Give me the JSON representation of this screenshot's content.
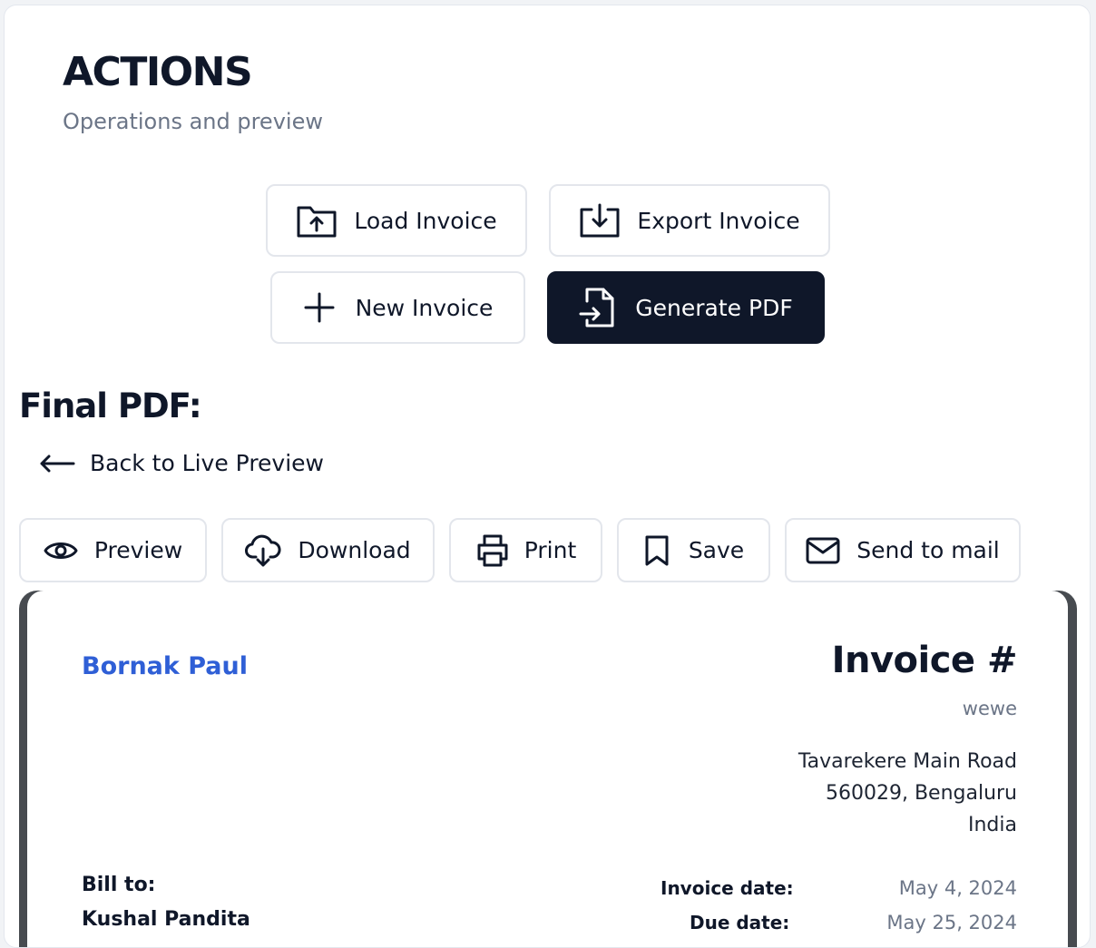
{
  "header": {
    "title": "ACTIONS",
    "subtitle": "Operations and preview"
  },
  "actions": {
    "load_label": "Load Invoice",
    "export_label": "Export Invoice",
    "new_label": "New Invoice",
    "generate_label": "Generate PDF"
  },
  "final_pdf": {
    "title": "Final PDF:",
    "back_label": "Back to Live Preview"
  },
  "toolbar": {
    "preview_label": "Preview",
    "download_label": "Download",
    "print_label": "Print",
    "save_label": "Save",
    "mail_label": "Send to mail"
  },
  "invoice": {
    "sender_name": "Bornak Paul",
    "heading": "Invoice #",
    "number": "wewe",
    "address": [
      "Tavarekere Main Road",
      "560029, Bengaluru",
      "India"
    ],
    "bill_to_label": "Bill to:",
    "client_name": "Kushal Pandita",
    "invoice_date_label": "Invoice date:",
    "invoice_date": "May 4, 2024",
    "due_date_label": "Due date:",
    "due_date": "May 25, 2024"
  },
  "colors": {
    "primary_dark": "#0f1729",
    "accent_blue": "#2f5fd6",
    "muted_text": "#6b7587"
  }
}
